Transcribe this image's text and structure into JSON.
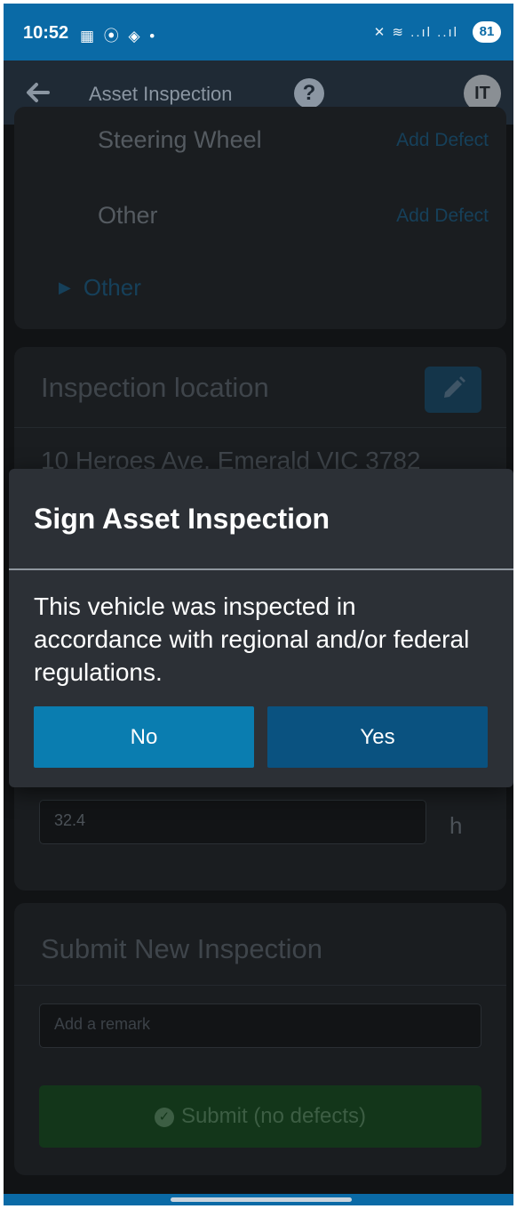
{
  "status_bar": {
    "time": "10:52",
    "left_icons": "▦ ⦿ ◈ •",
    "right_icons": "✕ ≋ ..ıl ..ıl",
    "battery": "81"
  },
  "app_bar": {
    "title": "Asset Inspection",
    "help_glyph": "?",
    "avatar_initials": "IT"
  },
  "defects": {
    "items": [
      {
        "label": "Steering Wheel",
        "action": "Add Defect"
      },
      {
        "label": "Other",
        "action": "Add Defect"
      }
    ],
    "section_toggle": "Other",
    "toggle_glyph": "▶"
  },
  "location": {
    "heading": "Inspection location",
    "address": "10 Heroes Ave, Emerald VIC 3782"
  },
  "hours": {
    "value": "32.4",
    "unit": "h"
  },
  "submit": {
    "heading": "Submit New Inspection",
    "remark_placeholder": "Add a remark",
    "button_label": "Submit (no defects)",
    "check_glyph": "✓"
  },
  "dialog": {
    "title": "Sign Asset Inspection",
    "message": "This vehicle was inspected in accordance with regional and/or federal regulations.",
    "no_label": "No",
    "yes_label": "Yes"
  },
  "colors": {
    "primary": "#0a6aa6",
    "dialog_no": "#0a7db0",
    "dialog_yes": "#0a5280",
    "dialog_bg": "#2c3036",
    "submit_green": "#13361a"
  }
}
